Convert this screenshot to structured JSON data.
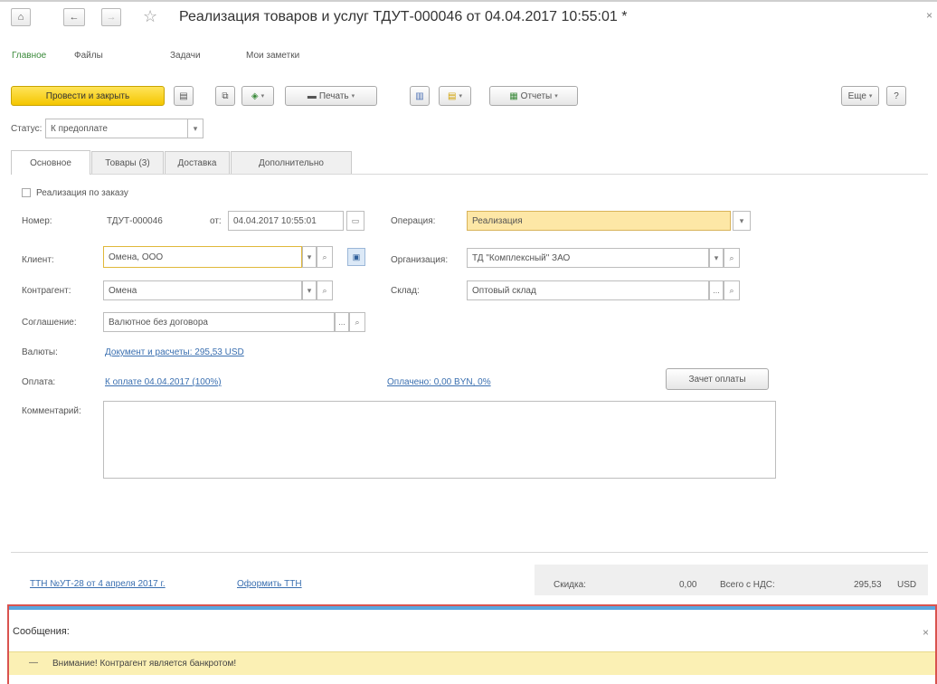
{
  "window": {
    "title": "Реализация товаров и услуг ТДУТ-000046 от 04.04.2017 10:55:01 *",
    "close_glyph": "×"
  },
  "icons": {
    "home": "⌂",
    "back": "←",
    "forward": "→",
    "star": "☆",
    "save": "▤",
    "copy": "⧉",
    "calendar": "▭",
    "chevron": "▾",
    "search": "⌕",
    "dots": "...",
    "pdf": "▣",
    "minus": "—"
  },
  "nav_tabs": [
    {
      "label": "Главное"
    },
    {
      "label": "Файлы"
    },
    {
      "label": "Задачи"
    },
    {
      "label": "Мои заметки"
    }
  ],
  "toolbar": {
    "post_close_label": "Провести и закрыть",
    "print_label": "Печать",
    "reports_label": "Отчеты",
    "more_label": "Еще",
    "help_label": "?"
  },
  "status": {
    "label": "Статус:",
    "value": "К предоплате"
  },
  "form_tabs": [
    {
      "label": "Основное"
    },
    {
      "label": "Товары (3)"
    },
    {
      "label": "Доставка"
    },
    {
      "label": "Дополнительно"
    }
  ],
  "form": {
    "by_order_label": "Реализация по заказу",
    "number_label": "Номер:",
    "number_value": "ТДУТ-000046",
    "from_label": "от:",
    "date_value": "04.04.2017 10:55:01",
    "operation_label": "Операция:",
    "operation_value": "Реализация",
    "client_label": "Клиент:",
    "client_value": "Омена, ООО",
    "organization_label": "Организация:",
    "organization_value": "ТД \"Комплексный\" ЗАО",
    "counterparty_label": "Контрагент:",
    "counterparty_value": "Омена",
    "warehouse_label": "Склад:",
    "warehouse_value": "Оптовый склад",
    "agreement_label": "Соглашение:",
    "agreement_value": "Валютное без договора",
    "currency_label": "Валюты:",
    "currency_link": "Документ и расчеты: 295,53 USD",
    "payment_label": "Оплата:",
    "payment_link": "К оплате 04.04.2017 (100%)",
    "paid_link": "Оплачено: 0,00 BYN, 0%",
    "offset_button": "Зачет оплаты",
    "comment_label": "Комментарий:",
    "comment_value": ""
  },
  "footer": {
    "ttn_link": "ТТН №УТ-28 от 4 апреля 2017 г.",
    "ttn_make_link": "Оформить ТТН",
    "discount_label": "Скидка:",
    "discount_value": "0,00",
    "total_label": "Всего с НДС:",
    "total_value": "295,53",
    "currency": "USD"
  },
  "messages": {
    "title": "Сообщения:",
    "items": [
      {
        "text": "Внимание! Контрагент является банкротом!"
      }
    ]
  }
}
